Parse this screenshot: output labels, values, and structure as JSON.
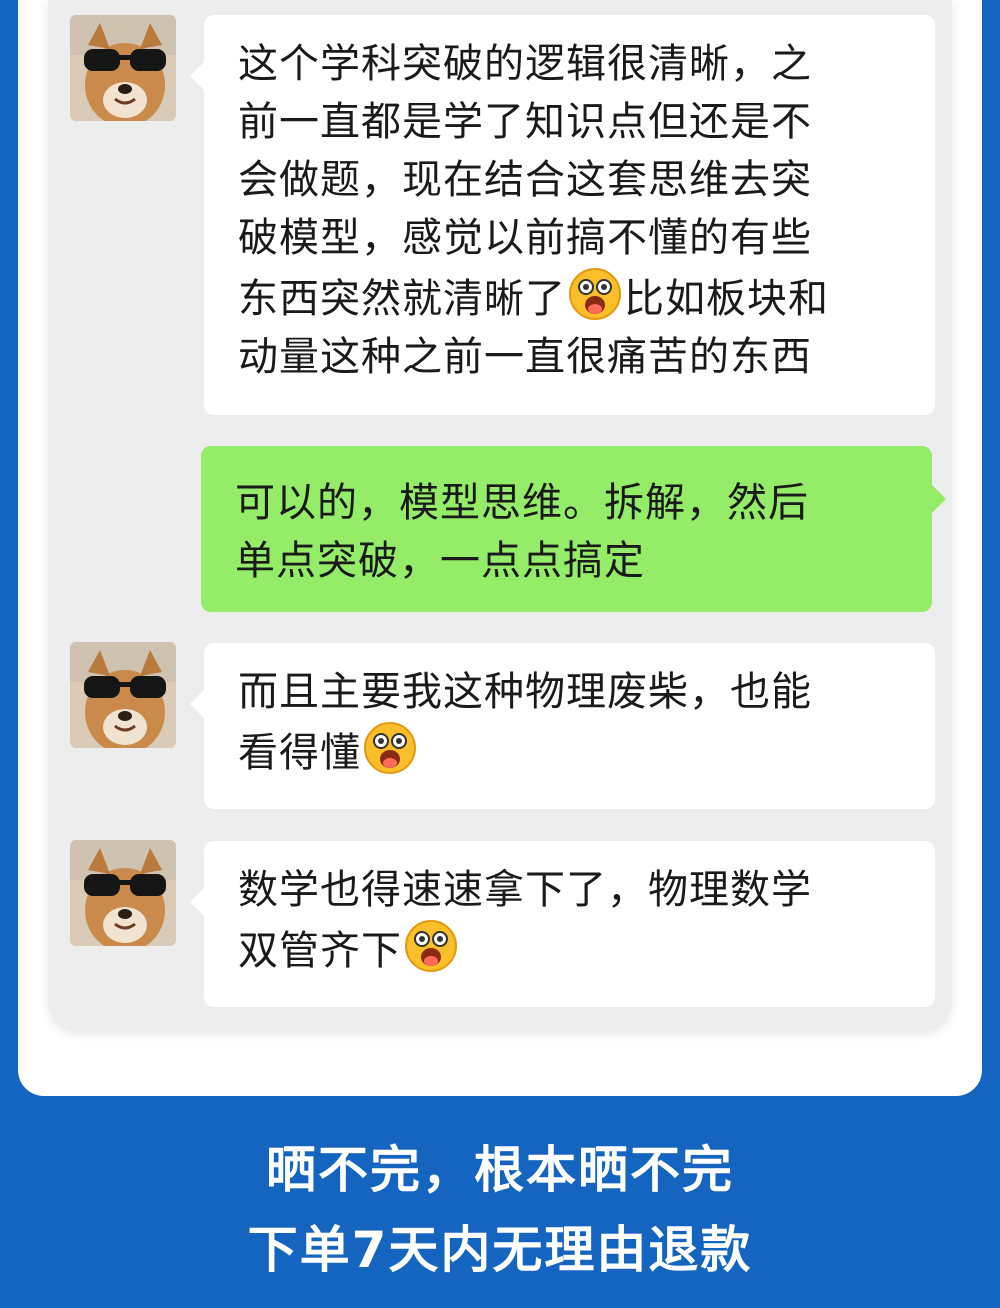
{
  "chat": {
    "messages": [
      {
        "sender": "contact",
        "lines": [
          "这个学科突破的逻辑很清晰，之",
          "前一直都是学了知识点但还是不",
          "会做题，现在结合这套思维去突",
          "破模型，感觉以前搞不懂的有些",
          [
            "东西突然就清晰了",
            "比如板块和"
          ],
          "动量这种之前一直很痛苦的东西"
        ]
      },
      {
        "sender": "me",
        "lines": [
          "可以的，模型思维。拆解，然后",
          "单点突破，一点点搞定"
        ]
      },
      {
        "sender": "contact",
        "lines": [
          "而且主要我这种物理废柴，也能",
          [
            "看得懂",
            ""
          ]
        ]
      },
      {
        "sender": "contact",
        "lines": [
          "数学也得速速拿下了，物理数学",
          [
            "双管齐下",
            ""
          ]
        ]
      }
    ]
  },
  "footer": {
    "line1": "晒不完，根本晒不完",
    "line2": "下单7天内无理由退款"
  },
  "emoji_icon": "starstruck-emoji-icon",
  "colors": {
    "background_blue": "#1565c0",
    "chat_bg": "#ededed",
    "incoming_bubble": "#ffffff",
    "outgoing_bubble": "#95ec69"
  }
}
